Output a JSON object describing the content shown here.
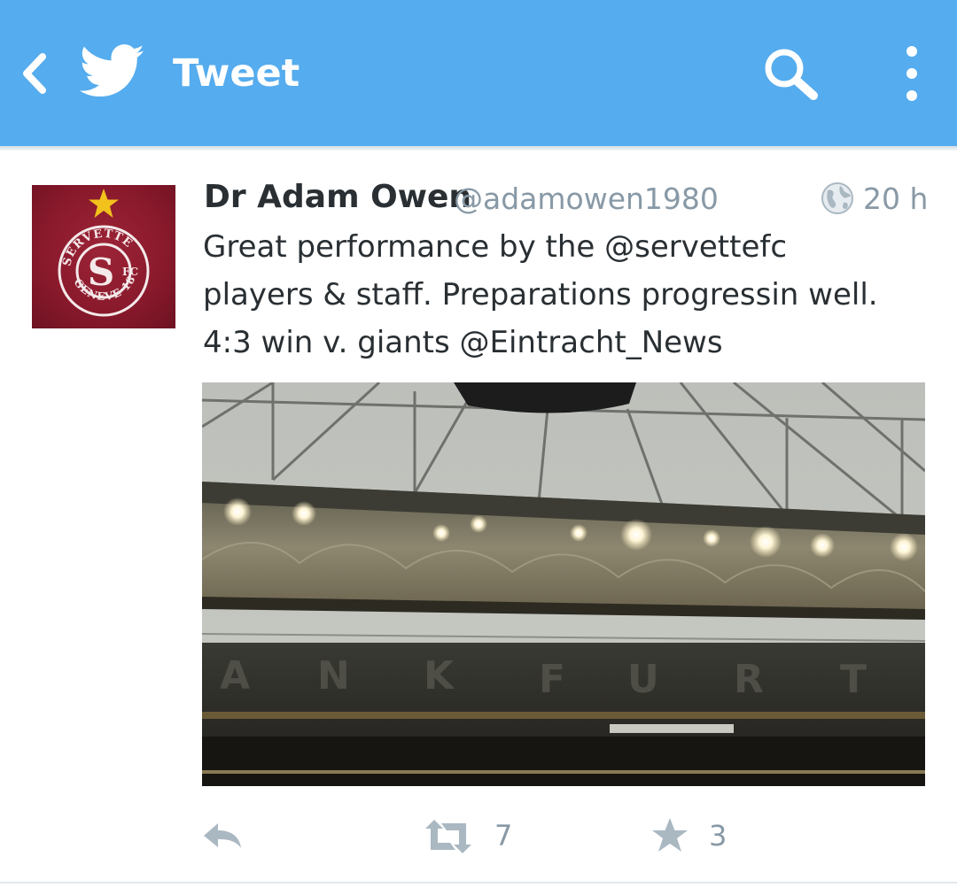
{
  "appbar": {
    "title": "Tweet",
    "background": "#55acee",
    "icons": [
      "back-icon",
      "twitter-bird-icon",
      "search-icon",
      "more-vertical-icon"
    ]
  },
  "tweet": {
    "author_name": "Dr Adam Owen",
    "author_handle": "@adamowen1980",
    "timestamp": "20 h",
    "text_lines": [
      "Great performance by the @servettefc",
      "players & staff. Preparations progressin well.",
      "4:3 win v. giants @Eintracht_News"
    ],
    "avatar": {
      "logo_text_top": "SERVETTE",
      "logo_letter": "S",
      "logo_fc": "FC",
      "logo_text_bottom": "GENEVE 1890",
      "background": "#8a1a2c"
    },
    "photo_alt": "Stadium roof under a grey sky"
  },
  "actions": {
    "retweet_count": "7",
    "favorite_count": "3",
    "icons": [
      "reply-icon",
      "retweet-icon",
      "favorite-star-icon"
    ]
  },
  "colors": {
    "text": "#292f33",
    "secondary": "#8899a6",
    "accent": "#55acee"
  }
}
